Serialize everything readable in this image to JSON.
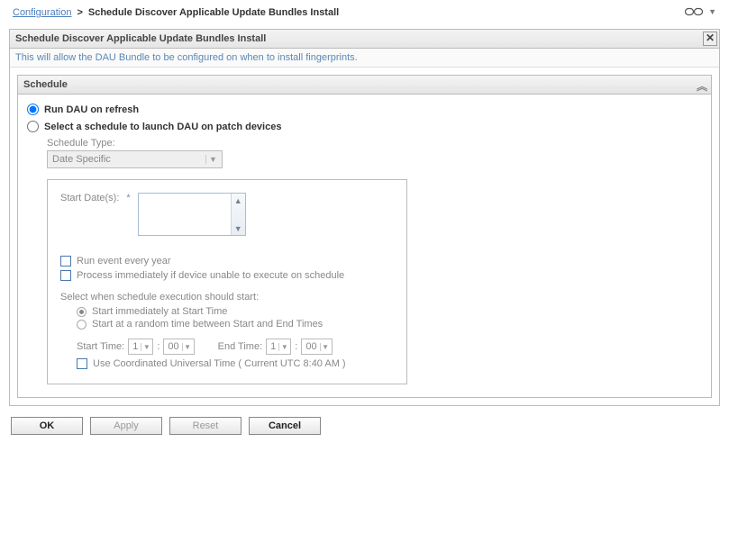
{
  "breadcrumb": {
    "root": "Configuration",
    "sep": ">",
    "current": "Schedule Discover Applicable Update Bundles Install"
  },
  "panel": {
    "title": "Schedule Discover Applicable Update Bundles Install",
    "description": "This will allow the DAU Bundle to be configured on when to install fingerprints."
  },
  "section": {
    "title": "Schedule"
  },
  "options": {
    "run_refresh": "Run DAU on refresh",
    "select_schedule": "Select a schedule to launch DAU on patch devices"
  },
  "schedule_type": {
    "label": "Schedule Type:",
    "value": "Date Specific"
  },
  "box": {
    "start_dates_label": "Start Date(s):",
    "required": "*",
    "run_every_year": "Run event every year",
    "process_immediately": "Process immediately if device unable to execute on schedule",
    "exec_start_label": "Select when schedule execution should start:",
    "start_immediate": "Start immediately at Start Time",
    "start_random": "Start at a random time between Start and End Times",
    "start_time_label": "Start Time:",
    "end_time_label": "End Time:",
    "hour1": "1",
    "min1": "00",
    "hour2": "1",
    "min2": "00",
    "utc_label": "Use Coordinated Universal Time ( Current UTC 8:40 AM )"
  },
  "buttons": {
    "ok": "OK",
    "apply": "Apply",
    "reset": "Reset",
    "cancel": "Cancel"
  }
}
